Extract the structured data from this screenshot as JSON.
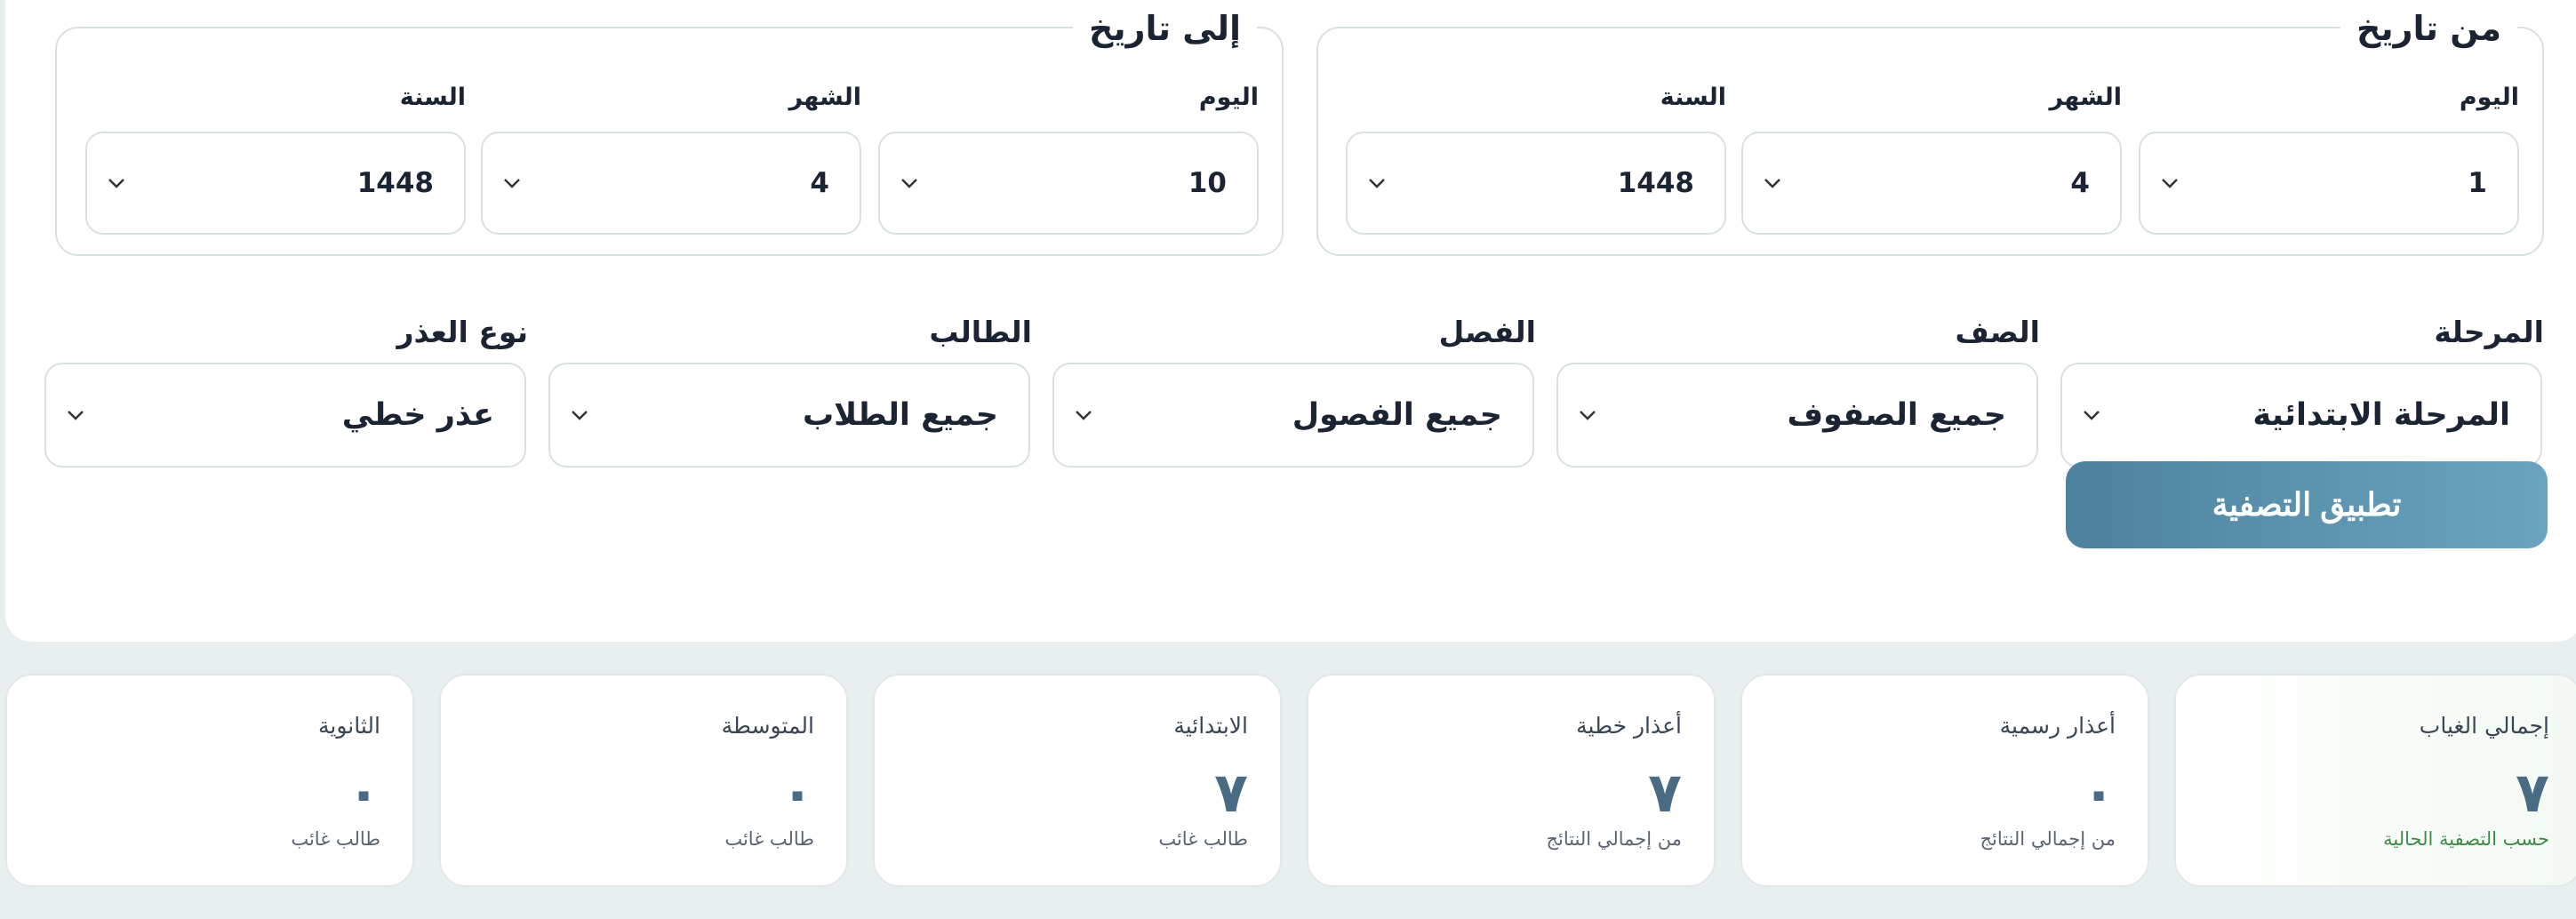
{
  "from_date": {
    "legend": "من تاريخ",
    "day": {
      "label": "اليوم",
      "value": "1"
    },
    "month": {
      "label": "الشهر",
      "value": "4"
    },
    "year": {
      "label": "السنة",
      "value": "1448"
    }
  },
  "to_date": {
    "legend": "إلى تاريخ",
    "day": {
      "label": "اليوم",
      "value": "10"
    },
    "month": {
      "label": "الشهر",
      "value": "4"
    },
    "year": {
      "label": "السنة",
      "value": "1448"
    }
  },
  "filters": {
    "stage": {
      "label": "المرحلة",
      "value": "المرحلة الابتدائية"
    },
    "grade": {
      "label": "الصف",
      "value": "جميع الصفوف"
    },
    "class": {
      "label": "الفصل",
      "value": "جميع الفصول"
    },
    "student": {
      "label": "الطالب",
      "value": "جميع الطلاب"
    },
    "excuse_type": {
      "label": "نوع العذر",
      "value": "عذر خطي"
    }
  },
  "apply_button": "تطبيق التصفية",
  "stats": [
    {
      "title": "إجمالي الغياب",
      "value": "٧",
      "sub": "حسب التصفية الحالية"
    },
    {
      "title": "أعذار رسمية",
      "value": "٠",
      "sub": "من إجمالي النتائج"
    },
    {
      "title": "أعذار خطية",
      "value": "٧",
      "sub": "من إجمالي النتائج"
    },
    {
      "title": "الابتدائية",
      "value": "٧",
      "sub": "طالب غائب"
    },
    {
      "title": "المتوسطة",
      "value": "٠",
      "sub": "طالب غائب"
    },
    {
      "title": "الثانوية",
      "value": "٠",
      "sub": "طالب غائب"
    }
  ],
  "icons": {
    "dropdown": "chevron-down-icon"
  },
  "colors": {
    "accent": "#5a91ad",
    "value": "#4a6b84",
    "green": "#3f8a4a"
  }
}
